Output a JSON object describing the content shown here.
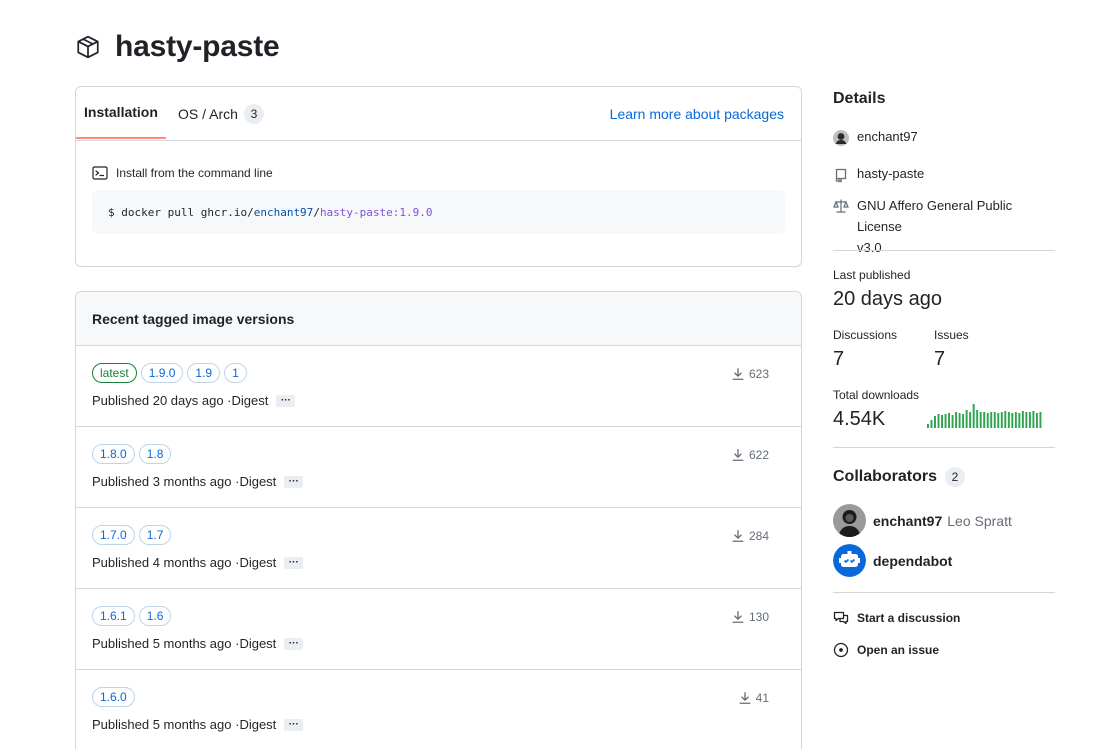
{
  "package": {
    "name": "hasty-paste",
    "icon": "package-icon"
  },
  "install": {
    "tabs": [
      {
        "label": "Installation"
      },
      {
        "label": "OS / Arch",
        "count": "3"
      }
    ],
    "learn_more": "Learn more about packages",
    "command_label": "Install from the command line",
    "command_prefix": "$ docker pull ghcr.io/",
    "command_owner": "enchant97",
    "command_sep": "/",
    "command_image": "hasty-paste:1.9.0"
  },
  "versions": {
    "title": "Recent tagged image versions",
    "digest_label": "Digest",
    "rows": [
      {
        "tags": [
          "latest",
          "1.9.0",
          "1.9",
          "1"
        ],
        "published": "Published 20 days ago · ",
        "downloads": "623"
      },
      {
        "tags": [
          "1.8.0",
          "1.8"
        ],
        "published": "Published 3 months ago · ",
        "downloads": "622"
      },
      {
        "tags": [
          "1.7.0",
          "1.7"
        ],
        "published": "Published 4 months ago · ",
        "downloads": "284"
      },
      {
        "tags": [
          "1.6.1",
          "1.6"
        ],
        "published": "Published 5 months ago · ",
        "downloads": "130"
      },
      {
        "tags": [
          "1.6.0"
        ],
        "published": "Published 5 months ago · ",
        "downloads": "41"
      }
    ]
  },
  "sidebar": {
    "details_title": "Details",
    "owner": "enchant97",
    "repo": "hasty-paste",
    "license_line1": "GNU Affero General Public License",
    "license_line2": "v3.0",
    "last_published_label": "Last published",
    "last_published_value": "20 days ago",
    "discussions_label": "Discussions",
    "discussions_value": "7",
    "issues_label": "Issues",
    "issues_value": "7",
    "total_downloads_label": "Total downloads",
    "total_downloads_value": "4.54K",
    "download_activity": [
      4,
      8,
      12,
      14,
      13,
      14,
      15,
      13,
      16,
      15,
      14,
      18,
      16,
      24,
      18,
      16,
      16,
      15,
      16,
      16,
      15,
      16,
      17,
      16,
      15,
      16,
      15,
      17,
      16,
      16,
      17,
      15,
      16
    ],
    "accent_color": "#2da44e",
    "collaborators_title": "Collaborators",
    "collaborators_count": "2",
    "collaborators": [
      {
        "login": "enchant97",
        "name": "Leo Spratt"
      },
      {
        "login": "dependabot",
        "name": ""
      }
    ],
    "start_discussion": "Start a discussion",
    "open_issue": "Open an issue"
  }
}
